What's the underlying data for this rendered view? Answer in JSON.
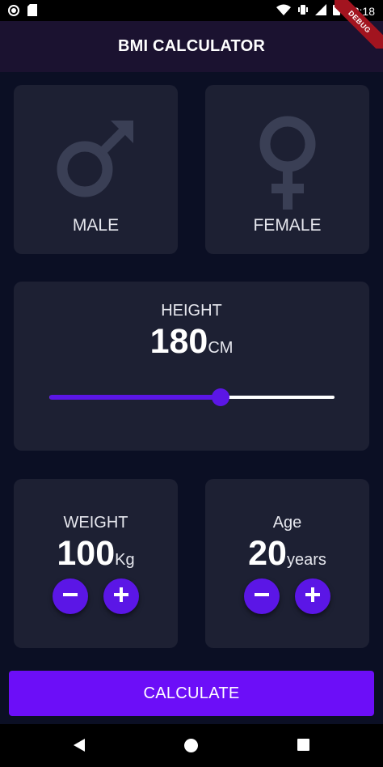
{
  "status_bar": {
    "time": "12:18",
    "left_icons": [
      "circle-record-icon",
      "sd-card-icon"
    ],
    "right_icons": [
      "wifi-icon",
      "vibrate-icon",
      "cell-signal-icon",
      "battery-icon"
    ]
  },
  "app_bar": {
    "title": "BMI CALCULATOR",
    "debug_banner": "DEBUG"
  },
  "gender": {
    "male_label": "MALE",
    "female_label": "FEMALE",
    "icon_color": "#3a3f55"
  },
  "height": {
    "label": "HEIGHT",
    "value": "180",
    "unit": "CM",
    "slider_fraction": 0.6
  },
  "weight": {
    "label": "WEIGHT",
    "value": "100",
    "unit": "Kg"
  },
  "age": {
    "label": "Age",
    "value": "20",
    "unit": "years"
  },
  "calculate_label": "CALCULATE",
  "colors": {
    "background": "#0b0f24",
    "card": "#1d2033",
    "accent": "#5b16e6",
    "button": "#6c0ef8"
  },
  "nav": [
    "back-icon",
    "home-icon",
    "recents-icon"
  ]
}
